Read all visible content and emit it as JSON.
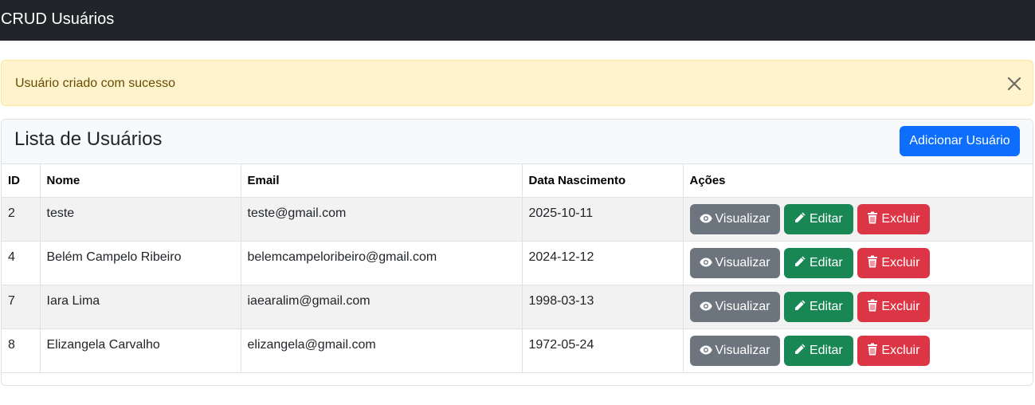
{
  "navbar": {
    "brand": "CRUD Usuários"
  },
  "alert": {
    "message": "Usuário criado com sucesso"
  },
  "card": {
    "title": "Lista de Usuários",
    "add_button": "Adicionar Usuário"
  },
  "table": {
    "headers": [
      "ID",
      "Nome",
      "Email",
      "Data Nascimento",
      "Ações"
    ],
    "rows": [
      {
        "id": "2",
        "nome": "teste",
        "email": "teste@gmail.com",
        "data": "2025-10-11"
      },
      {
        "id": "4",
        "nome": "Belém Campelo Ribeiro",
        "email": "belemcampeloribeiro@gmail.com",
        "data": "2024-12-12"
      },
      {
        "id": "7",
        "nome": "Iara Lima",
        "email": "iaearalim@gmail.com",
        "data": "1998-03-13"
      },
      {
        "id": "8",
        "nome": "Elizangela Carvalho",
        "email": "elizangela@gmail.com",
        "data": "1972-05-24"
      }
    ],
    "actions": {
      "view": "Visualizar",
      "edit": "Editar",
      "delete": "Excluir"
    }
  },
  "colors": {
    "navbar": "#212529",
    "alert_bg": "#fff3cd",
    "primary": "#0d6efd",
    "secondary": "#6c757d",
    "success": "#198754",
    "danger": "#dc3545"
  },
  "icons": {
    "close": "close-icon",
    "view": "eye-icon",
    "edit": "pencil-icon",
    "delete": "trash-icon"
  }
}
